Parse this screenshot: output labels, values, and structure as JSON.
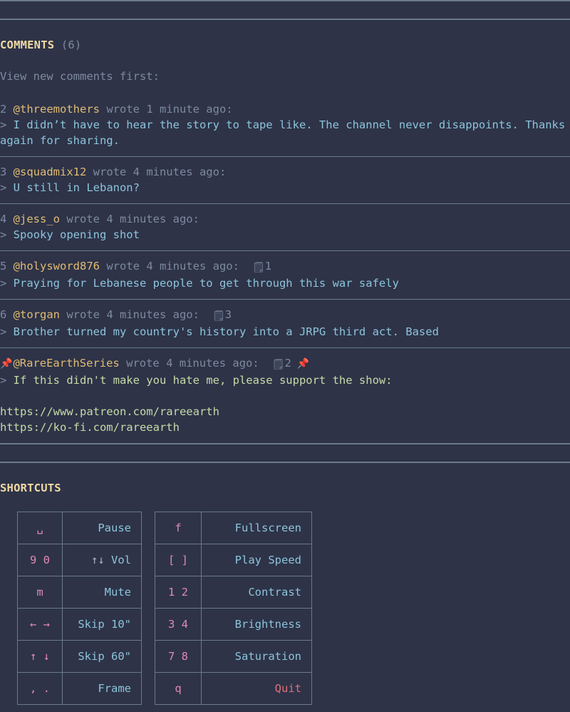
{
  "theme": {
    "background": "#2e3348",
    "divider": "#6b7a8c",
    "heading": "#f1d9a4",
    "muted": "#7d8aa0",
    "username": "#e0bc72",
    "body_text": "#8cc4da",
    "link_green": "#c6dca6",
    "key_pink": "#e08ab0",
    "danger": "#e0707a",
    "pin_red": "#e05c6e"
  },
  "comments_section": {
    "heading": "COMMENTS",
    "count_label": "(6)",
    "sort_note": "View new comments first:",
    "thumb_icon": "🗒",
    "pin_icon": "📌",
    "caret": ">",
    "comments": [
      {
        "index": "2",
        "user": "@threemothers",
        "wrote": "wrote 1 minute ago:",
        "likes": "",
        "body": "I didn’t have to hear the story to tape like. The channel never disappoints. Thanks again for sharing.",
        "pinned": false
      },
      {
        "index": "3",
        "user": "@squadmix12",
        "wrote": "wrote 4 minutes ago:",
        "likes": "",
        "body": "U still in Lebanon?",
        "pinned": false
      },
      {
        "index": "4",
        "user": "@jess_o",
        "wrote": "wrote 4 minutes ago:",
        "likes": "",
        "body": "Spooky opening shot",
        "pinned": false
      },
      {
        "index": "5",
        "user": "@holysword876",
        "wrote": "wrote 4 minutes ago:",
        "likes": "1",
        "body": "Praying for Lebanese people to get through this war safely",
        "pinned": false
      },
      {
        "index": "6",
        "user": "@torgan",
        "wrote": "wrote 4 minutes ago:",
        "likes": "3",
        "body": "Brother turned my country's history into a JRPG third act. Based",
        "pinned": false
      },
      {
        "index": "",
        "user": "@RareEarthSeries",
        "wrote": "wrote 4 minutes ago:",
        "likes": "2",
        "body": "If this didn't make you hate me, please support the show:",
        "pinned": true,
        "links": [
          "https://www.patreon.com/rareearth",
          "https://ko-fi.com/rareearth"
        ]
      }
    ]
  },
  "shortcuts_section": {
    "heading": "SHORTCUTS",
    "left_table": [
      {
        "key": "␣",
        "label": "Pause",
        "arrows": "",
        "danger": false
      },
      {
        "key": "9 0",
        "label": "Vol",
        "arrows": "↑↓ ",
        "danger": false
      },
      {
        "key": "m",
        "label": "Mute",
        "arrows": "",
        "danger": false
      },
      {
        "key": "← →",
        "label": "Skip 10\"",
        "arrows": "",
        "danger": false
      },
      {
        "key": "↑ ↓",
        "label": "Skip 60\"",
        "arrows": "",
        "danger": false
      },
      {
        "key": ", .",
        "label": "Frame",
        "arrows": "",
        "danger": false
      }
    ],
    "right_table": [
      {
        "key": "f",
        "label": "Fullscreen",
        "arrows": "",
        "danger": false
      },
      {
        "key": "[ ]",
        "label": "Play Speed",
        "arrows": "",
        "danger": false
      },
      {
        "key": "1 2",
        "label": "Contrast",
        "arrows": "",
        "danger": false
      },
      {
        "key": "3 4",
        "label": "Brightness",
        "arrows": "",
        "danger": false
      },
      {
        "key": "7 8",
        "label": "Saturation",
        "arrows": "",
        "danger": false
      },
      {
        "key": "q",
        "label": "Quit",
        "arrows": "",
        "danger": true
      }
    ]
  }
}
